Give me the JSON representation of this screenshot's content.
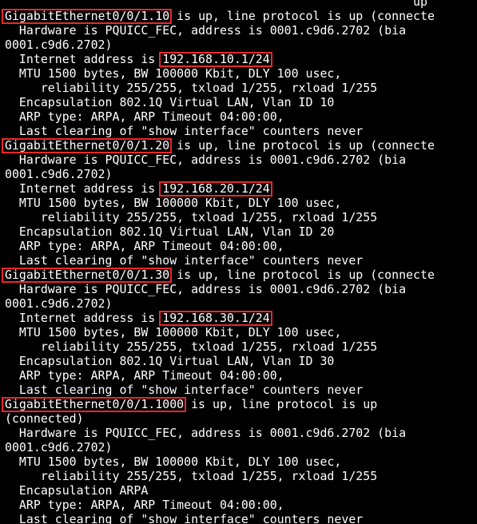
{
  "terminal": {
    "highlight_color": "#e8282b",
    "lines": [
      {
        "text": "                                                         up"
      },
      {
        "before": "",
        "hl": "GigabitEthernet0/0/1.10",
        "after": " is up, line protocol is up (connecte"
      },
      {
        "text": "  Hardware is PQUICC_FEC, address is 0001.c9d6.2702 (bia"
      },
      {
        "text": "0001.c9d6.2702)"
      },
      {
        "before": "  Internet address is ",
        "hl": "192.168.10.1/24",
        "after": ""
      },
      {
        "text": "  MTU 1500 bytes, BW 100000 Kbit, DLY 100 usec,"
      },
      {
        "text": "     reliability 255/255, txload 1/255, rxload 1/255"
      },
      {
        "text": "  Encapsulation 802.1Q Virtual LAN, Vlan ID 10"
      },
      {
        "text": "  ARP type: ARPA, ARP Timeout 04:00:00,"
      },
      {
        "text": "  Last clearing of \"show interface\" counters never"
      },
      {
        "before": "",
        "hl": "GigabitEthernet0/0/1.20",
        "after": " is up, line protocol is up (connecte"
      },
      {
        "text": "  Hardware is PQUICC_FEC, address is 0001.c9d6.2702 (bia"
      },
      {
        "text": "0001.c9d6.2702)"
      },
      {
        "before": "  Internet address is ",
        "hl": "192.168.20.1/24",
        "after": ""
      },
      {
        "text": "  MTU 1500 bytes, BW 100000 Kbit, DLY 100 usec,"
      },
      {
        "text": "     reliability 255/255, txload 1/255, rxload 1/255"
      },
      {
        "text": "  Encapsulation 802.1Q Virtual LAN, Vlan ID 20"
      },
      {
        "text": "  ARP type: ARPA, ARP Timeout 04:00:00,"
      },
      {
        "text": "  Last clearing of \"show interface\" counters never"
      },
      {
        "before": "",
        "hl": "GigabitEthernet0/0/1.30",
        "after": " is up, line protocol is up (connecte"
      },
      {
        "text": "  Hardware is PQUICC_FEC, address is 0001.c9d6.2702 (bia"
      },
      {
        "text": "0001.c9d6.2702)"
      },
      {
        "before": "  Internet address is ",
        "hl": "192.168.30.1/24",
        "after": ""
      },
      {
        "text": "  MTU 1500 bytes, BW 100000 Kbit, DLY 100 usec,"
      },
      {
        "text": "     reliability 255/255, txload 1/255, rxload 1/255"
      },
      {
        "text": "  Encapsulation 802.1Q Virtual LAN, Vlan ID 30"
      },
      {
        "text": "  ARP type: ARPA, ARP Timeout 04:00:00,"
      },
      {
        "text": "  Last clearing of \"show interface\" counters never"
      },
      {
        "before": "",
        "hl": "GigabitEthernet0/0/1.1000",
        "after": " is up, line protocol is up"
      },
      {
        "text": "(connected)"
      },
      {
        "text": "  Hardware is PQUICC_FEC, address is 0001.c9d6.2702 (bia"
      },
      {
        "text": "0001.c9d6.2702)"
      },
      {
        "text": "  MTU 1500 bytes, BW 100000 Kbit, DLY 100 usec,"
      },
      {
        "text": "     reliability 255/255, txload 1/255, rxload 1/255"
      },
      {
        "text": "  Encapsulation ARPA"
      },
      {
        "text": "  ARP type: ARPA, ARP Timeout 04:00:00,"
      },
      {
        "text": "  Last clearing of \"show interface\" counters never"
      }
    ]
  }
}
